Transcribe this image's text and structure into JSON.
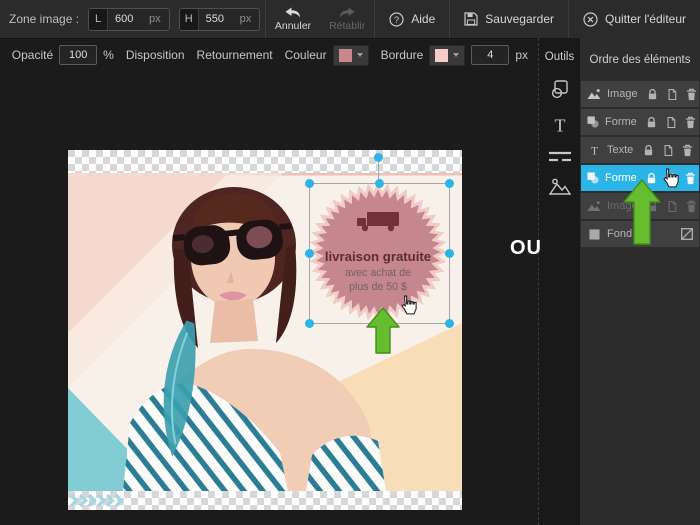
{
  "topbar": {
    "zone_label": "Zone image :",
    "width_field": {
      "label": "L",
      "value": "600",
      "unit": "px"
    },
    "height_field": {
      "label": "H",
      "value": "550",
      "unit": "px"
    },
    "undo_label": "Annuler",
    "redo_label": "Rétablir",
    "help_label": "Aide",
    "save_label": "Sauvegarder",
    "quit_label": "Quitter l'éditeur"
  },
  "properties_bar": {
    "opacity_label": "Opacité",
    "opacity_value": "100",
    "opacity_unit": "%",
    "disposition_label": "Disposition",
    "flip_label": "Retournement",
    "color_label": "Couleur",
    "color_value": "#c9868c",
    "border_label": "Bordure",
    "border_color_value": "#f4cdc9",
    "border_width_value": "4",
    "border_width_unit": "px"
  },
  "tools_panel": {
    "title": "Outils",
    "tools": [
      "shapes-tool",
      "text-tool",
      "lines-tool",
      "image-tool"
    ]
  },
  "layers_panel": {
    "title": "Ordre des éléments",
    "layers": [
      {
        "type": "image",
        "label": "Image",
        "state": "normal"
      },
      {
        "type": "shape",
        "label": "Forme",
        "state": "normal"
      },
      {
        "type": "text",
        "label": "Texte",
        "state": "normal"
      },
      {
        "type": "shape",
        "label": "Forme",
        "state": "selected"
      },
      {
        "type": "image",
        "label": "Image",
        "state": "dimmed"
      },
      {
        "type": "background",
        "label": "Fond",
        "state": "normal"
      }
    ]
  },
  "canvas": {
    "or_label": "OU",
    "badge": {
      "icon": "truck-icon",
      "title": "livraison gratuite",
      "line2": "avec achat de",
      "line3": "plus de 50 $",
      "fill": "#c5878d",
      "border": "#f2cbc7",
      "icon_color": "#73303a",
      "title_color": "#5f2b33",
      "subtitle_color": "#6e6268"
    }
  },
  "colors": {
    "accent": "#2ab5e6",
    "arrow_green": "#65bd2f",
    "topbar_bg": "#2b2b2b",
    "editor_bg": "#1b1b1b",
    "panel_bg": "#2c2c2c",
    "row_bg": "#404040"
  }
}
